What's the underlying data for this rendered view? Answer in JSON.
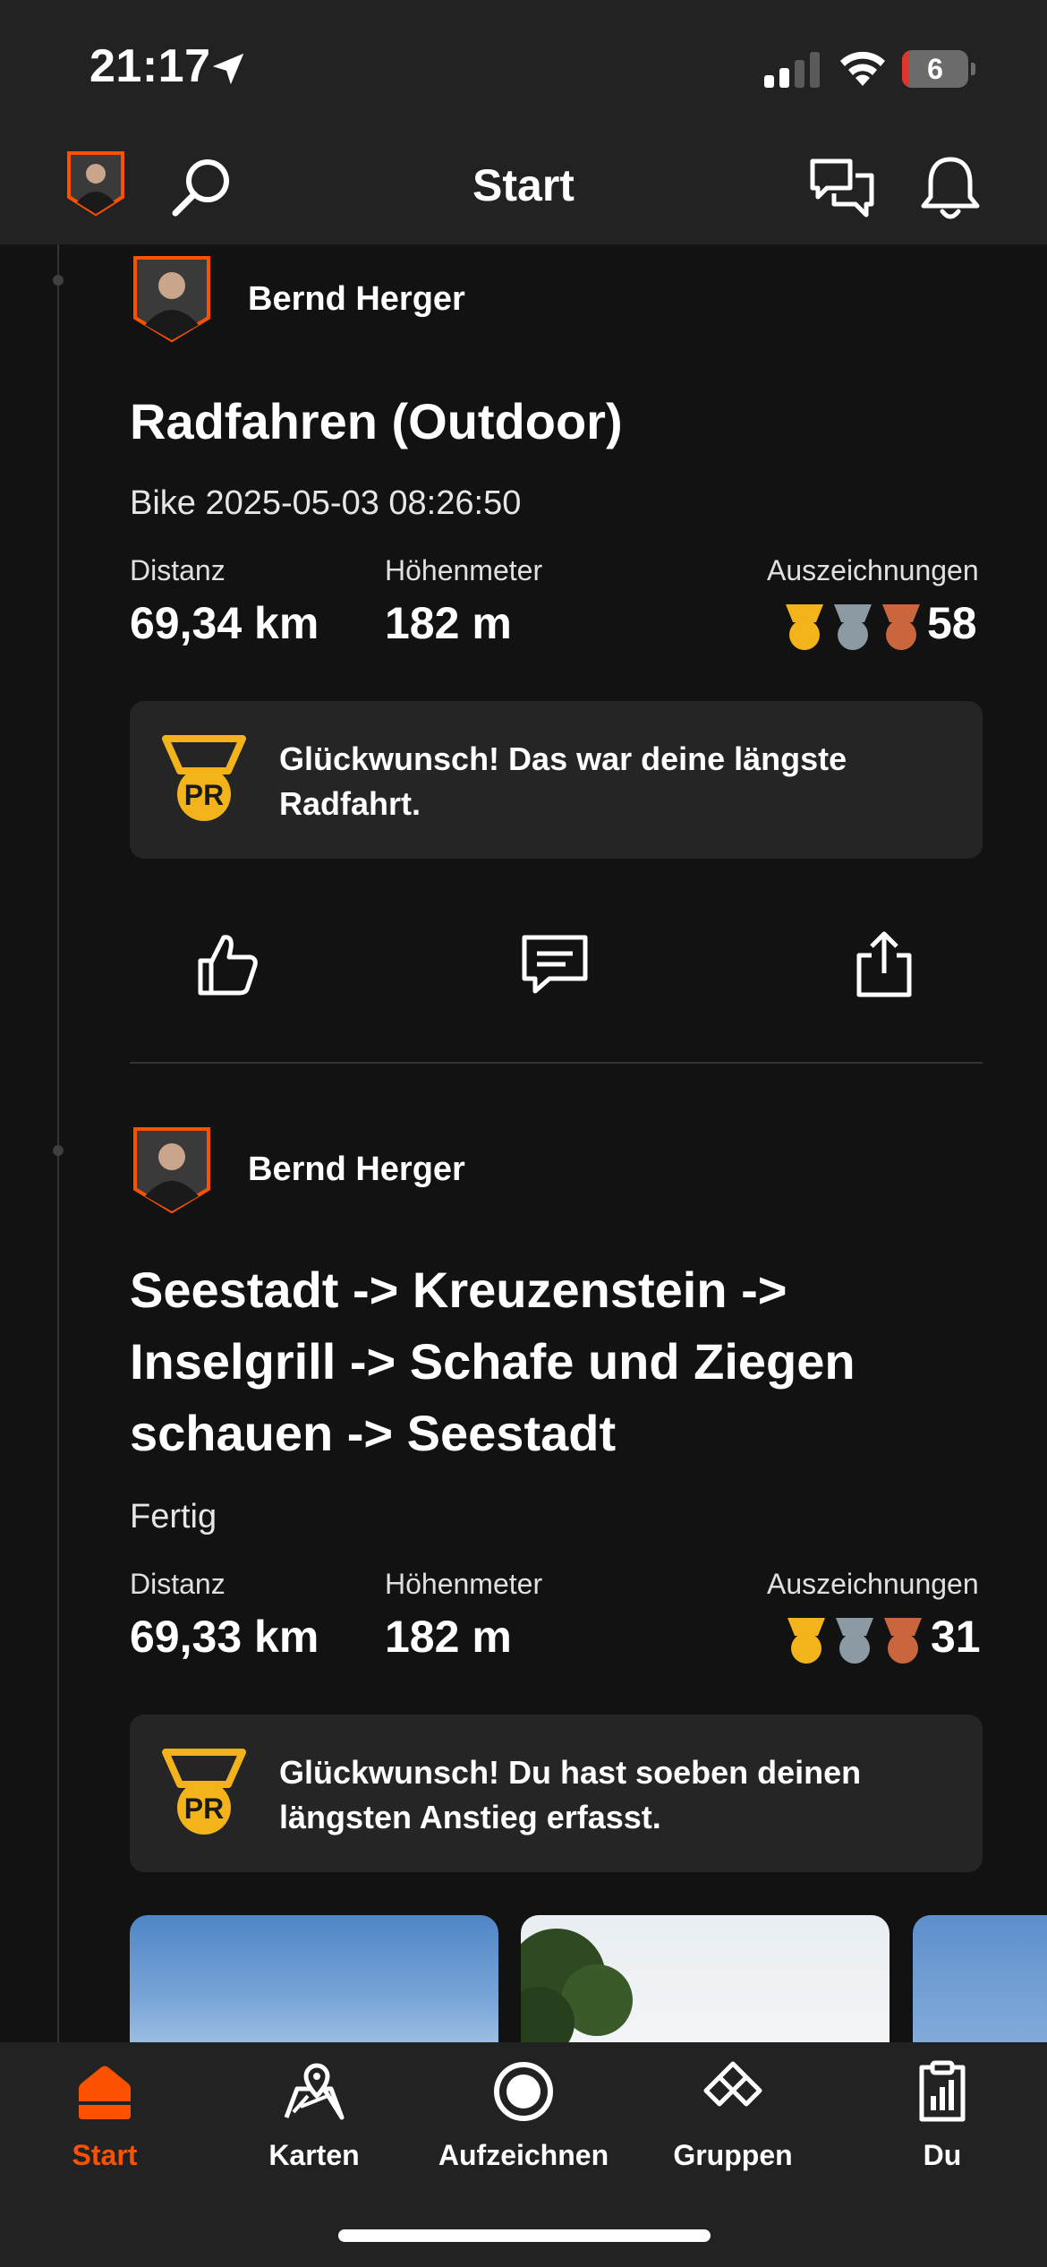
{
  "status_bar": {
    "time": "21:17",
    "battery_level": "6"
  },
  "nav": {
    "title": "Start"
  },
  "feed": [
    {
      "athlete": "Bernd Herger",
      "title": "Radfahren (Outdoor)",
      "subtitle": "Bike 2025-05-03 08:26:50",
      "stats": [
        {
          "label": "Distanz",
          "value": "69,34 km"
        },
        {
          "label": "Höhenmeter",
          "value": "182 m"
        }
      ],
      "awards_label": "Auszeichnungen",
      "awards_count": "58",
      "pr_text": "Glückwunsch! Das war deine längste Radfahrt.",
      "pr_badge": "PR"
    },
    {
      "athlete": "Bernd Herger",
      "title": "Seestadt -> Kreuzenstein -> Inselgrill -> Schafe und Ziegen schauen -> Seestadt",
      "subtitle": "Fertig",
      "stats": [
        {
          "label": "Distanz",
          "value": "69,33 km"
        },
        {
          "label": "Höhenmeter",
          "value": "182 m"
        }
      ],
      "awards_label": "Auszeichnungen",
      "awards_count": "31",
      "pr_text": "Glückwunsch! Du hast soeben deinen längsten Anstieg erfasst.",
      "pr_badge": "PR"
    }
  ],
  "tabs": [
    {
      "label": "Start",
      "icon": "home-icon",
      "active": true
    },
    {
      "label": "Karten",
      "icon": "map-icon",
      "active": false
    },
    {
      "label": "Aufzeichnen",
      "icon": "record-icon",
      "active": false
    },
    {
      "label": "Gruppen",
      "icon": "groups-icon",
      "active": false
    },
    {
      "label": "Du",
      "icon": "clipboard-stats-icon",
      "active": false
    }
  ],
  "colors": {
    "accent": "#fc5200",
    "background": "#121212",
    "bar": "#222222",
    "card": "#252525",
    "gold": "#f2b31b",
    "silver": "#8c9aa3",
    "bronze": "#c9663e"
  }
}
